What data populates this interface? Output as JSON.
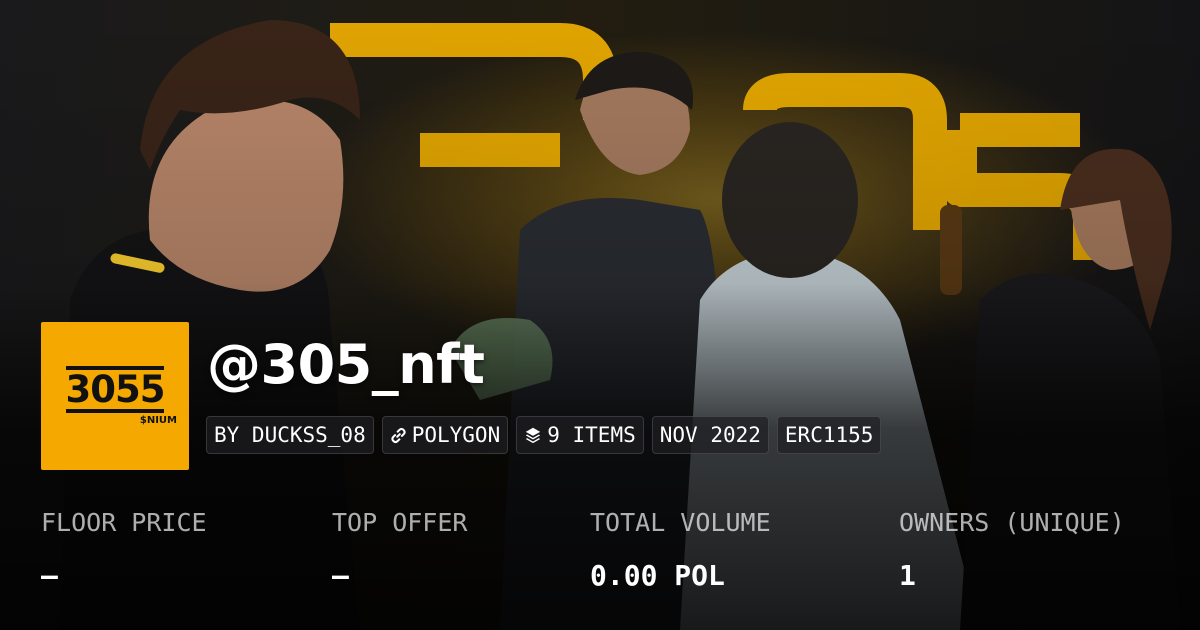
{
  "background": {
    "description_icon": "artwork-banner",
    "accent": "#f5b400"
  },
  "logo": {
    "main": "3055",
    "sub": "$NIUM",
    "bg": "#f5a800"
  },
  "collection": {
    "title": "@305_nft"
  },
  "chips": {
    "creator": "BY DUCKSS_08",
    "chain": "POLYGON",
    "items": "9 ITEMS",
    "date": "NOV 2022",
    "standard": "ERC1155"
  },
  "stats": {
    "floor": {
      "label": "FLOOR PRICE",
      "value": "–"
    },
    "offer": {
      "label": "TOP OFFER",
      "value": "–"
    },
    "volume": {
      "label": "TOTAL VOLUME",
      "value": "0.00 POL"
    },
    "owners": {
      "label": "OWNERS (UNIQUE)",
      "value": "1"
    }
  }
}
